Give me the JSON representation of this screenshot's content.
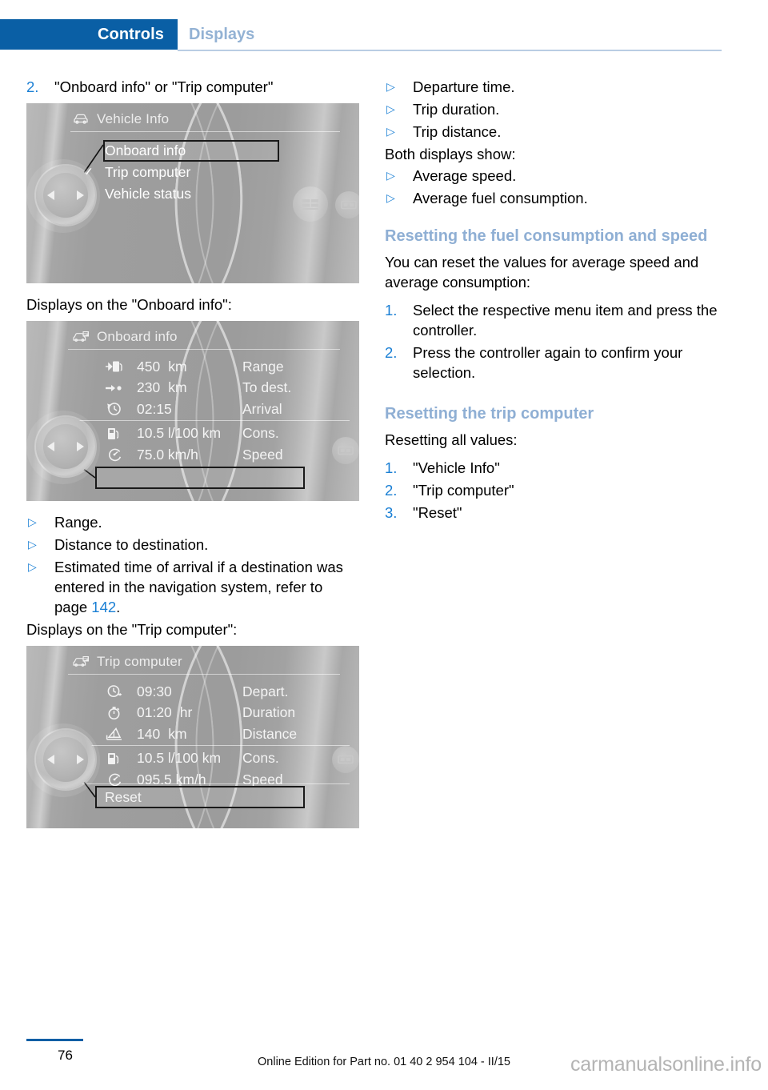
{
  "header": {
    "active_tab": "Controls",
    "inactive_tab": "Displays",
    "accent_blue": "#0a5fa5",
    "inactive_blue": "#93b2d4"
  },
  "left_column": {
    "step": {
      "number": "2.",
      "text": "\"Onboard info\" or \"Trip computer\""
    },
    "caption_onboard": "Displays on the \"Onboard info\":",
    "caption_trip": "Displays on the \"Trip computer\":",
    "bullets": [
      {
        "marker": "▷",
        "text": "Range."
      },
      {
        "marker": "▷",
        "text": "Distance to destination."
      },
      {
        "marker": "▷",
        "text": "Estimated time of arrival if a destination was entered in the navigation system, refer to page ",
        "link": "142",
        "tail": "."
      }
    ],
    "figure_vehicle_info": {
      "title": "Vehicle Info",
      "title_icon": "car-icon",
      "items": [
        {
          "label": "Onboard info",
          "selected": true,
          "checked": false
        },
        {
          "label": "Trip computer",
          "selected": false,
          "checked": true
        },
        {
          "label": "Vehicle status",
          "selected": false,
          "checked": false
        }
      ],
      "controller_icon": "idrive-controller-icon",
      "right_buttons": [
        "menu-button-icon",
        "display-button-icon"
      ]
    },
    "figure_onboard_info": {
      "title": "Onboard info",
      "title_icon": "onboard-display-icon",
      "rows": [
        {
          "icon": "fuel-range-icon",
          "value": "450",
          "unit": "km",
          "label": "Range",
          "selected": false
        },
        {
          "icon": "to-destination-icon",
          "value": "230",
          "unit": "km",
          "label": "To dest.",
          "selected": false
        },
        {
          "icon": "arrival-clock-icon",
          "value": "02:15",
          "unit": "",
          "label": "Arrival",
          "selected": false
        },
        {
          "icon": "fuel-pump-icon",
          "value": "10.5 l/100 km",
          "unit": "",
          "label": "Cons.",
          "selected": false
        },
        {
          "icon": "speedometer-icon",
          "value": "75.0 km/h",
          "unit": "",
          "label": "Speed",
          "selected": true
        }
      ],
      "separator_after_row": 3,
      "controller_icon": "idrive-controller-icon",
      "right_buttons": [
        "display-button-icon"
      ]
    },
    "figure_trip_computer": {
      "title": "Trip computer",
      "title_icon": "onboard-display-icon",
      "rows": [
        {
          "icon": "departure-clock-icon",
          "value": "09:30",
          "unit": "",
          "label": "Depart.",
          "selected": false
        },
        {
          "icon": "stopwatch-icon",
          "value": "01:20",
          "unit": "hr",
          "label": "Duration",
          "selected": false
        },
        {
          "icon": "distance-icon",
          "value": "140",
          "unit": "km",
          "label": "Distance",
          "selected": false
        },
        {
          "icon": "fuel-pump-icon",
          "value": "10.5 l/100 km",
          "unit": "",
          "label": "Cons.",
          "selected": false
        },
        {
          "icon": "speedometer-icon",
          "value": "095.5 km/h",
          "unit": "",
          "label": "Speed",
          "selected": false
        }
      ],
      "separator_after_row": 3,
      "reset_button": "Reset",
      "controller_icon": "idrive-controller-icon",
      "right_buttons": [
        "display-button-icon"
      ]
    }
  },
  "right_column": {
    "bullets_top": [
      {
        "marker": "▷",
        "text": "Departure time."
      },
      {
        "marker": "▷",
        "text": "Trip duration."
      },
      {
        "marker": "▷",
        "text": "Trip distance."
      }
    ],
    "both_displays_label": "Both displays show:",
    "bullets_both": [
      {
        "marker": "▷",
        "text": "Average speed."
      },
      {
        "marker": "▷",
        "text": "Average fuel consumption."
      }
    ],
    "heading_reset_fuel": "Resetting the fuel consumption and speed",
    "intro_reset_fuel": "You can reset the values for average speed and average consumption:",
    "steps_reset_fuel": [
      {
        "number": "1.",
        "text": "Select the respective menu item and press the controller."
      },
      {
        "number": "2.",
        "text": "Press the controller again to confirm your selection."
      }
    ],
    "heading_reset_trip": "Resetting the trip computer",
    "intro_reset_trip": "Resetting all values:",
    "steps_reset_trip": [
      {
        "number": "1.",
        "text": "\"Vehicle Info\""
      },
      {
        "number": "2.",
        "text": "\"Trip computer\""
      },
      {
        "number": "3.",
        "text": "\"Reset\""
      }
    ]
  },
  "footer": {
    "page_number": "76",
    "note": "Online Edition for Part no. 01 40 2 954 104 - II/15",
    "watermark": "carmanualsonline.info"
  }
}
